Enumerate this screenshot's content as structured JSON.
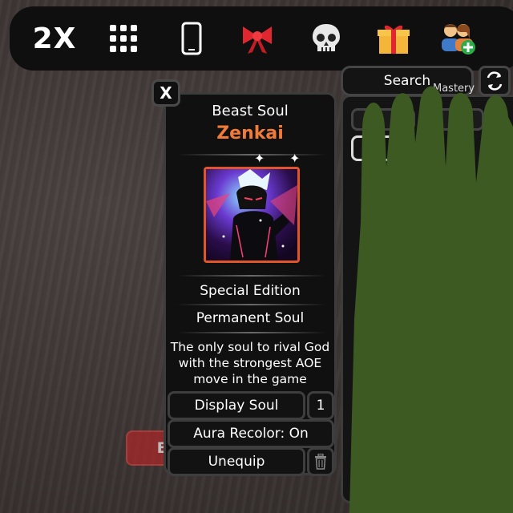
{
  "topbar": {
    "speed_label": "2X",
    "icons": [
      "menu-grid-icon",
      "phone-icon",
      "ribbon-bow-icon",
      "skull-icon",
      "gift-icon",
      "add-friends-icon"
    ]
  },
  "soul_panel": {
    "close_label": "X",
    "soul_type": "Beast Soul",
    "soul_name": "Zenkai",
    "edition": "Special Edition",
    "permanence": "Permanent Soul",
    "description": "The only soul to rival God with the strongest AOE move in the game",
    "display_button": "Display Soul",
    "display_count": "1",
    "aura_button": "Aura Recolor: On",
    "unequip_button": "Unequip"
  },
  "exit_label": "Exit",
  "inventory": {
    "search_label": "Search",
    "mastery_label": "Mastery"
  },
  "colors": {
    "soul_name": "#f07a3a",
    "exit_button": "#a8282a",
    "redaction_green": "#3d5a22"
  }
}
